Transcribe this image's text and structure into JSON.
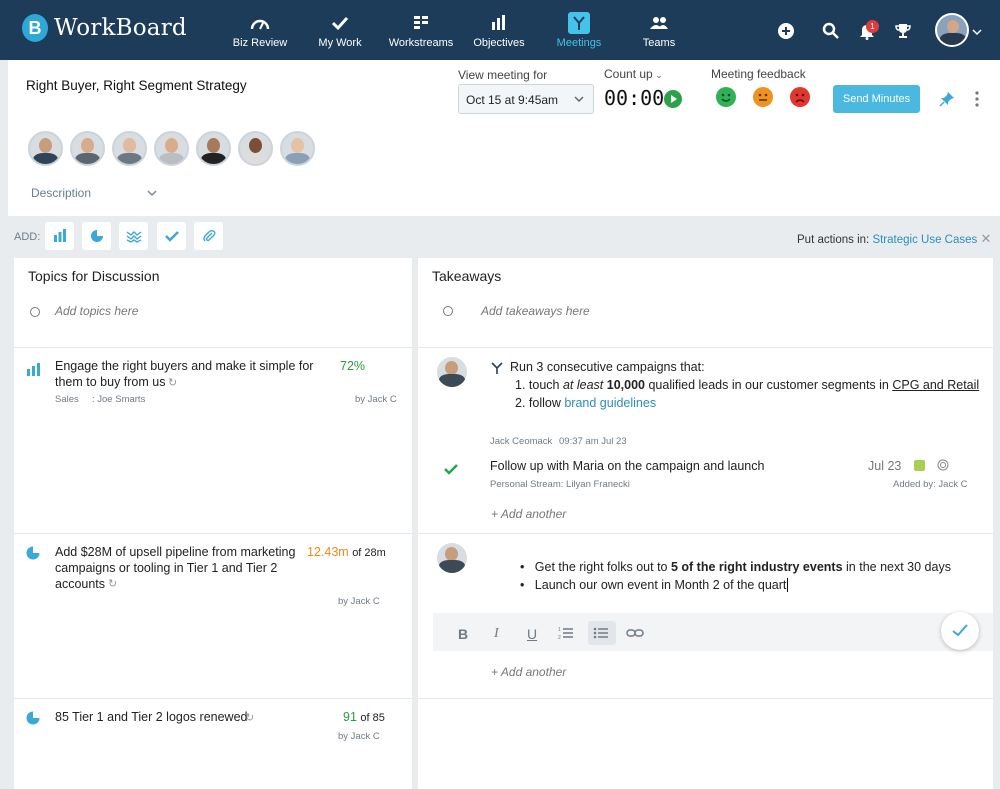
{
  "app": {
    "name": "WorkBoard"
  },
  "nav": {
    "items": [
      {
        "label": "Biz Review",
        "icon": "gauge-icon"
      },
      {
        "label": "My Work",
        "icon": "check-icon"
      },
      {
        "label": "Workstreams",
        "icon": "workstreams-icon"
      },
      {
        "label": "Objectives",
        "icon": "bar-chart-icon"
      },
      {
        "label": "Meetings",
        "icon": "meetings-icon"
      },
      {
        "label": "Teams",
        "icon": "teams-icon"
      }
    ],
    "notifications": "1"
  },
  "meeting": {
    "title": "Right Buyer, Right Segment Strategy",
    "view_label": "View meeting for",
    "view_value": "Oct 15 at 9:45am",
    "count_label": "Count up",
    "timer": "00:00",
    "feedback_label": "Meeting feedback",
    "send_label": "Send Minutes",
    "description_label": "Description"
  },
  "add": {
    "label": "ADD:",
    "put_actions_label": "Put actions in:",
    "put_actions_link": "Strategic Use Cases"
  },
  "topics": {
    "title": "Topics for Discussion",
    "placeholder": "Add topics here",
    "items": [
      {
        "text": "Engage the right buyers and make it simple for them to buy from us",
        "value": "72%",
        "meta": "Sales",
        "team": ": Joe Smarts",
        "by": "by Jack C"
      },
      {
        "text": "Add $28M of upsell pipeline from marketing campaigns or tooling in Tier 1 and Tier 2 accounts",
        "value": "12.43m",
        "suffix": "of 28m",
        "by": "by Jack C"
      },
      {
        "text": "85 Tier 1 and Tier 2 logos renewed",
        "value": "91",
        "suffix": "of 85",
        "by": "by Jack C"
      }
    ]
  },
  "takeaways": {
    "title": "Takeaways",
    "placeholder": "Add takeaways here",
    "t1": {
      "lead": "Run 3 consecutive campaigns that:",
      "l1a": "1. touch ",
      "l1b": "at least",
      "l1c": " 10,000",
      "l1d": " qualified leads in our customer segments in ",
      "l1e": "CPG and Retail",
      "l2a": "2. follow ",
      "l2b": "brand guidelines",
      "author": "Jack Ceomack",
      "time": "09:37 am Jul 23"
    },
    "action": {
      "text": "Follow up with Maria on the campaign and launch",
      "date": "Jul 23",
      "stream": "Personal Stream: Lilyan Franecki",
      "added": "Added by:  Jack C"
    },
    "add_another": "+ Add another",
    "t2": {
      "b1a": "Get the right folks out to ",
      "b1b": "5 of the right industry events",
      "b1c": " in the next 30 days",
      "b2": "Launch our own event in Month 2 of the quart"
    }
  }
}
